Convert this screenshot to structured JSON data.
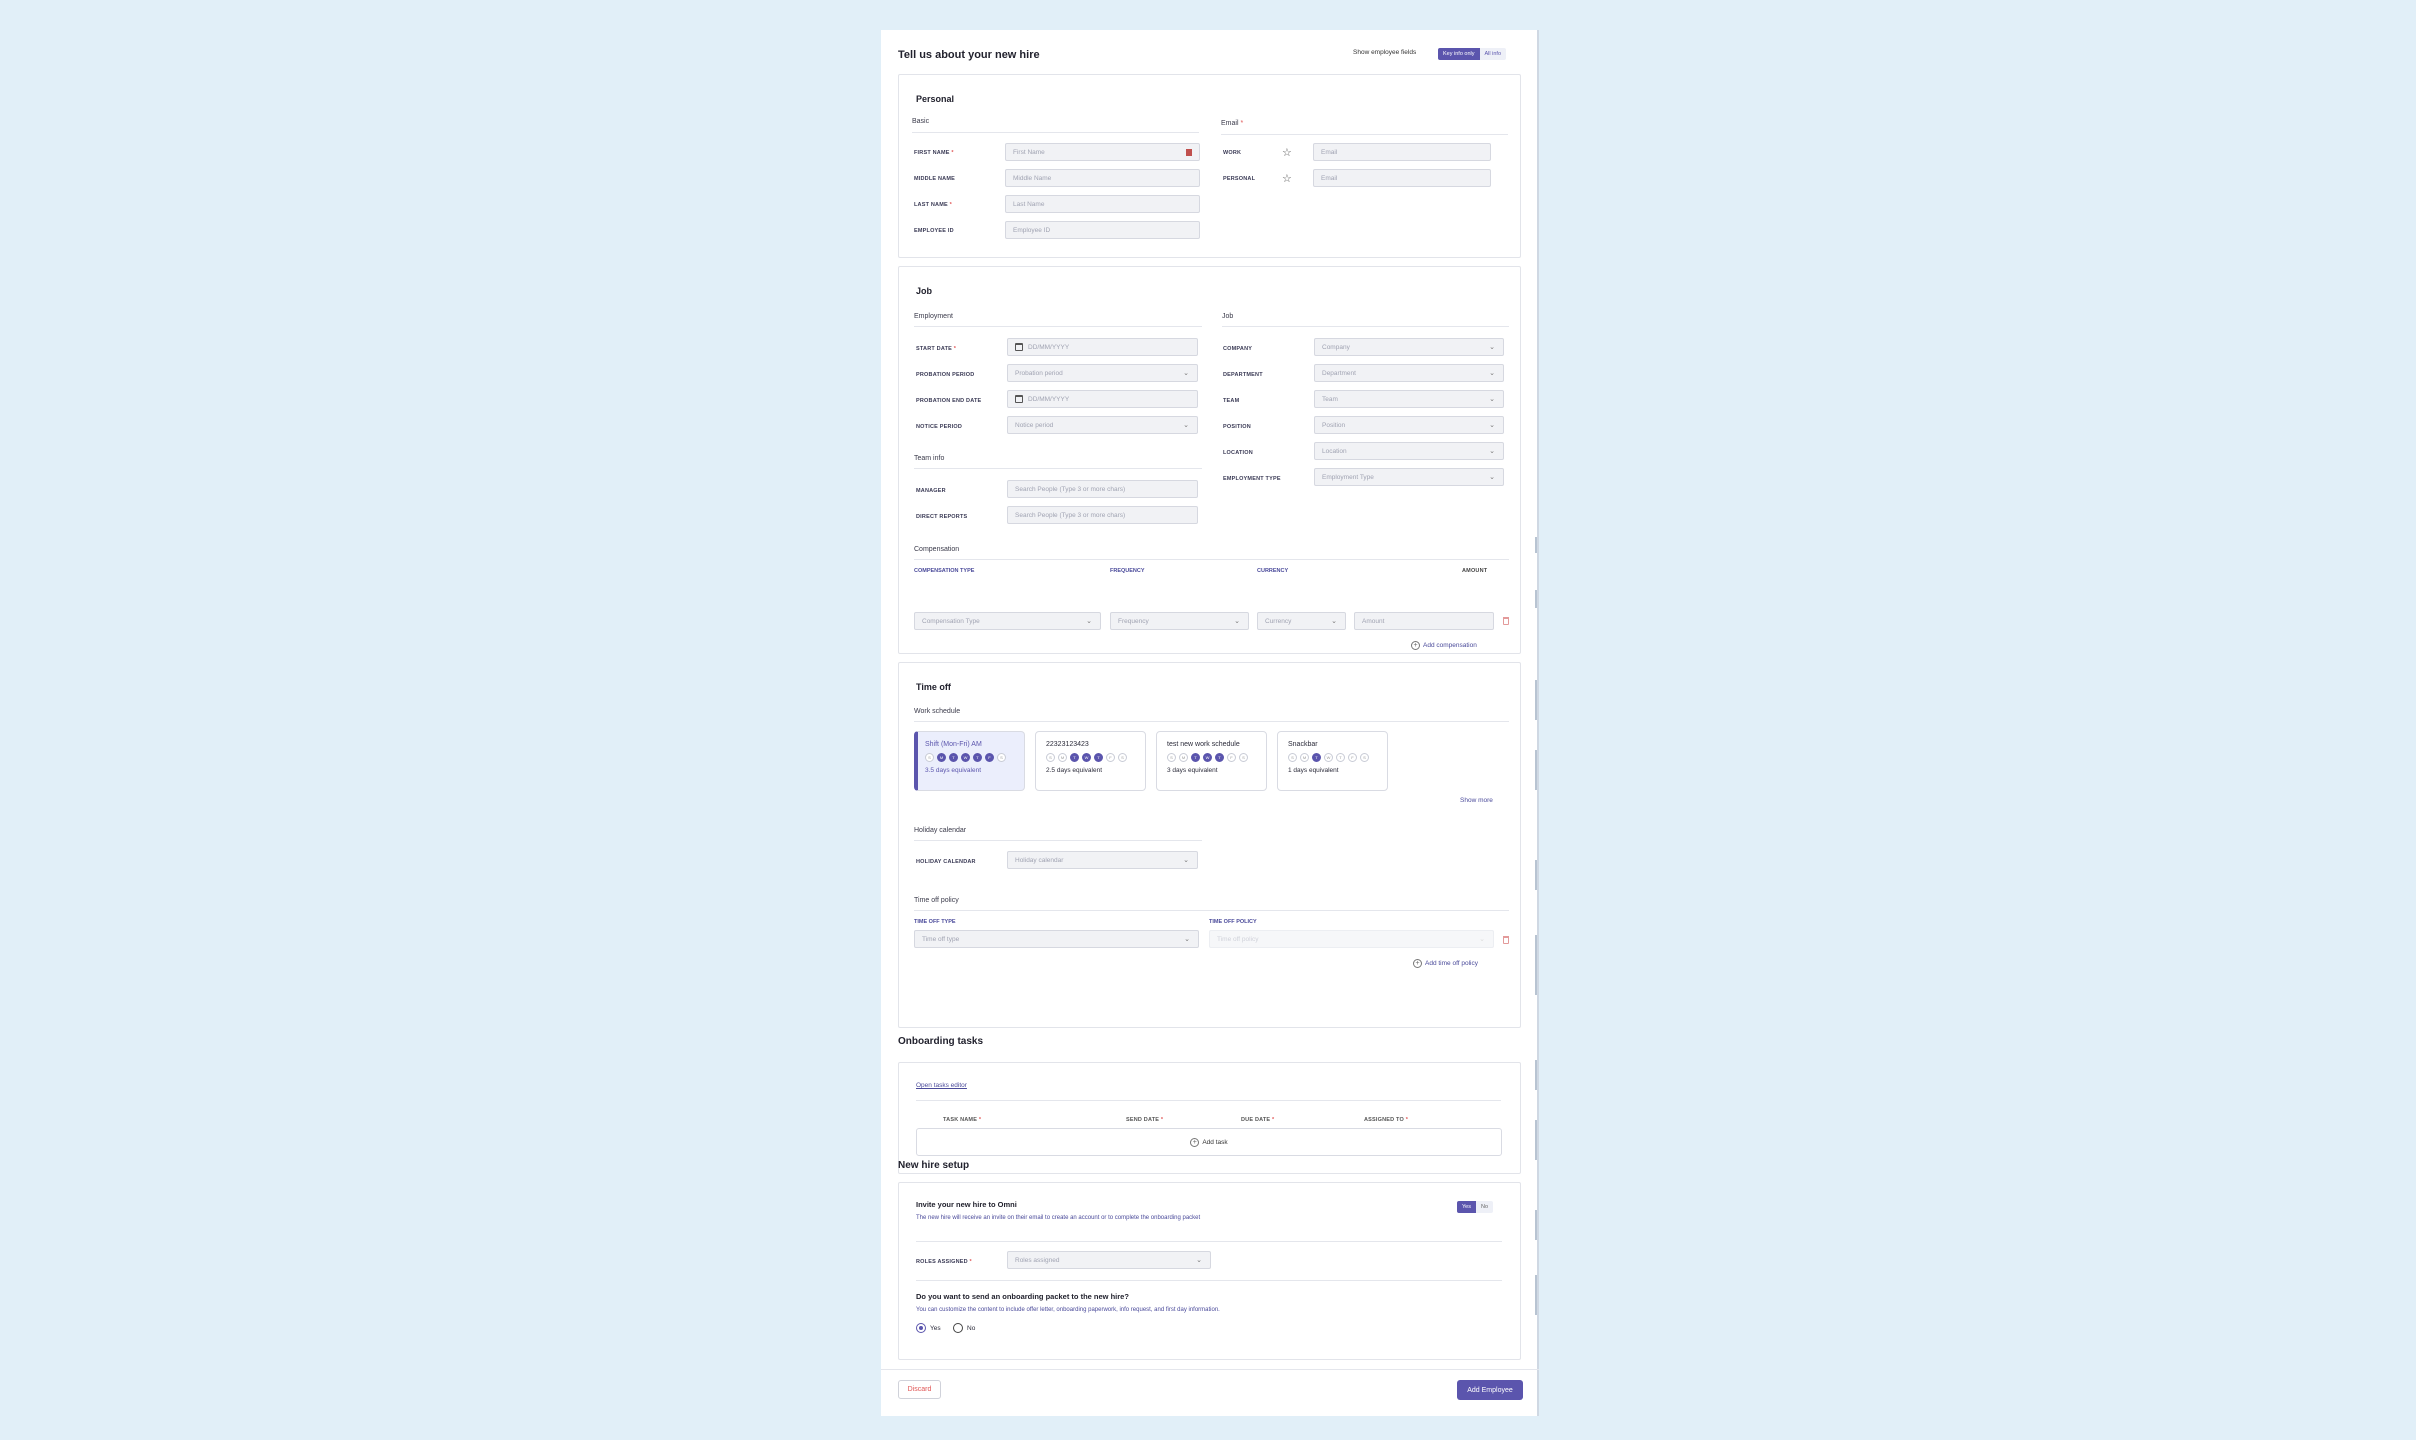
{
  "header": {
    "title": "Tell us about your new hire",
    "show_fields_label": "Show employee fields",
    "toggle": [
      "Key info only",
      "All info"
    ]
  },
  "personal": {
    "title": "Personal",
    "basic_label": "Basic",
    "email_label": "Email",
    "first_name": {
      "label": "FIRST NAME",
      "placeholder": "First Name"
    },
    "middle_name": {
      "label": "MIDDLE NAME",
      "placeholder": "Middle Name"
    },
    "last_name": {
      "label": "LAST NAME",
      "placeholder": "Last Name"
    },
    "employee_id": {
      "label": "EMPLOYEE ID",
      "placeholder": "Employee ID"
    },
    "work_email": {
      "label": "WORK",
      "placeholder": "Email"
    },
    "personal_email": {
      "label": "PERSONAL",
      "placeholder": "Email"
    }
  },
  "job": {
    "title": "Job",
    "employment_label": "Employment",
    "job_label": "Job",
    "start_date": {
      "label": "START DATE",
      "placeholder": "DD/MM/YYYY"
    },
    "probation_period": {
      "label": "PROBATION PERIOD",
      "placeholder": "Probation period"
    },
    "probation_end_date": {
      "label": "PROBATION END DATE",
      "placeholder": "DD/MM/YYYY"
    },
    "notice_period": {
      "label": "NOTICE PERIOD",
      "placeholder": "Notice period"
    },
    "team_info_label": "Team info",
    "manager": {
      "label": "MANAGER",
      "placeholder": "Search People (Type 3 or more chars)"
    },
    "direct_reports": {
      "label": "DIRECT REPORTS",
      "placeholder": "Search People (Type 3 or more chars)"
    },
    "company": {
      "label": "COMPANY",
      "placeholder": "Company"
    },
    "department": {
      "label": "DEPARTMENT",
      "placeholder": "Department"
    },
    "team": {
      "label": "TEAM",
      "placeholder": "Team"
    },
    "position": {
      "label": "POSITION",
      "placeholder": "Position"
    },
    "location": {
      "label": "LOCATION",
      "placeholder": "Location"
    },
    "employment_type": {
      "label": "EMPLOYMENT TYPE",
      "placeholder": "Employment Type"
    },
    "compensation": {
      "label": "Compensation",
      "type_label": "COMPENSATION TYPE",
      "type_placeholder": "Compensation Type",
      "frequency_label": "FREQUENCY",
      "frequency_placeholder": "Frequency",
      "currency_label": "CURRENCY",
      "currency_placeholder": "Currency",
      "amount_label": "AMOUNT",
      "amount_placeholder": "Amount",
      "add_label": "Add compensation"
    }
  },
  "time_off": {
    "title": "Time off",
    "work_schedule_label": "Work schedule",
    "schedules": [
      {
        "name": "Shift (Mon-Fri) AM",
        "days": [
          "S",
          "M",
          "T",
          "W",
          "T",
          "F",
          "S"
        ],
        "on": [
          false,
          true,
          true,
          true,
          true,
          true,
          false
        ],
        "equivalent": "3.5 days equivalent",
        "selected": true
      },
      {
        "name": "22323123423",
        "days": [
          "S",
          "M",
          "T",
          "W",
          "T",
          "F",
          "S"
        ],
        "on": [
          false,
          false,
          true,
          true,
          true,
          false,
          false
        ],
        "equivalent": "2.5 days equivalent",
        "selected": false
      },
      {
        "name": "test new work schedule",
        "days": [
          "S",
          "M",
          "T",
          "W",
          "T",
          "F",
          "S"
        ],
        "on": [
          false,
          false,
          true,
          true,
          true,
          false,
          false
        ],
        "equivalent": "3 days equivalent",
        "selected": false
      },
      {
        "name": "Snackbar",
        "days": [
          "S",
          "M",
          "T",
          "W",
          "T",
          "F",
          "S"
        ],
        "on": [
          false,
          false,
          true,
          false,
          false,
          false,
          false
        ],
        "equivalent": "1 days equivalent",
        "selected": false
      }
    ],
    "show_more": "Show more",
    "holiday_label": "Holiday calendar",
    "holiday_field": {
      "label": "HOLIDAY CALENDAR",
      "placeholder": "Holiday calendar"
    },
    "policy_label": "Time off policy",
    "type_field": {
      "label": "TIME OFF TYPE",
      "placeholder": "Time off type"
    },
    "policy_field": {
      "label": "TIME OFF POLICY",
      "placeholder": "Time off policy"
    },
    "add_policy": "Add time off policy"
  },
  "onboarding": {
    "title": "Onboarding tasks",
    "open_editor": "Open tasks editor",
    "columns": [
      "TASK NAME",
      "SEND DATE",
      "DUE DATE",
      "ASSIGNED TO"
    ],
    "add_task": "Add task"
  },
  "setup": {
    "title": "New hire setup",
    "invite_title": "Invite your new hire to Omni",
    "invite_desc": "The new hire will receive an invite on their email to create an account or to complete the onboarding packet",
    "invite_toggle": [
      "Yes",
      "No"
    ],
    "roles": {
      "label": "ROLES ASSIGNED",
      "placeholder": "Roles assigned"
    },
    "packet_title": "Do you want to send an onboarding packet to the new hire?",
    "packet_desc": "You can customize the content to include offer letter, onboarding paperwork, info request, and first day information.",
    "packet_yes": "Yes",
    "packet_no": "No"
  },
  "footer": {
    "discard": "Discard",
    "add_employee": "Add Employee"
  },
  "colors": {
    "accent": "#5b55ad",
    "background": "#e1eff8",
    "danger": "#e05555"
  }
}
